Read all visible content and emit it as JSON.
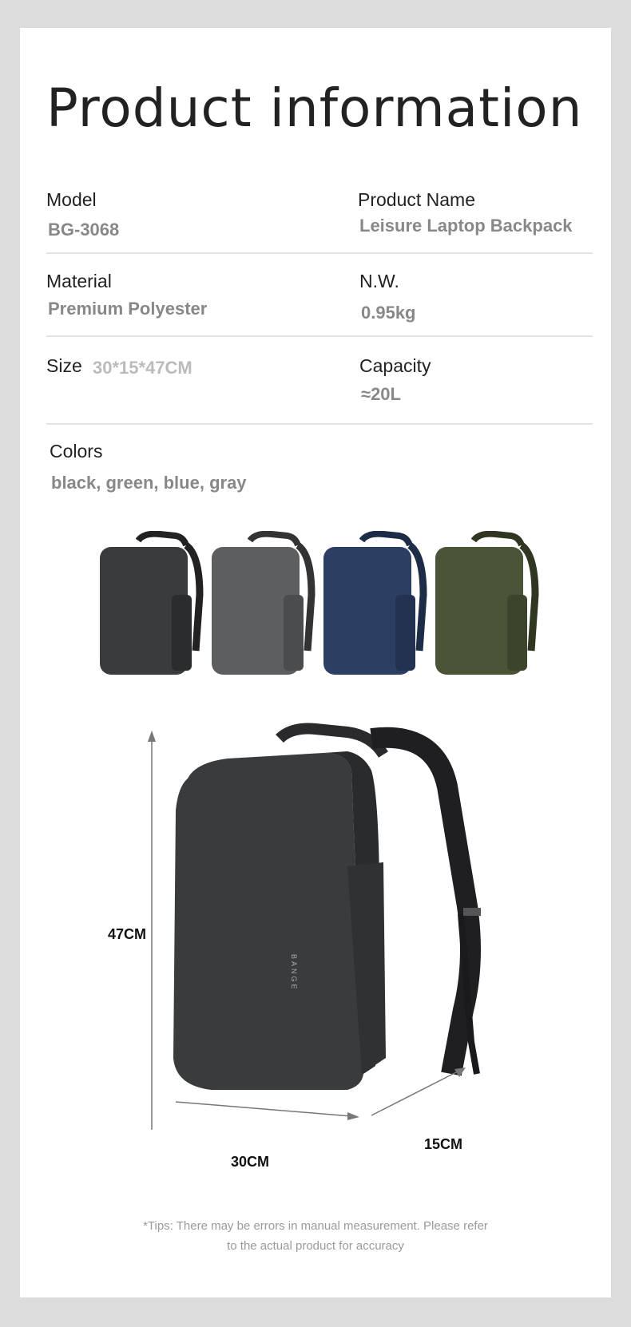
{
  "title": "Product information",
  "specs": {
    "model": {
      "label": "Model",
      "value": "BG-3068"
    },
    "product_name": {
      "label": "Product Name",
      "value": "Leisure Laptop Backpack"
    },
    "material": {
      "label": "Material",
      "value": "Premium Polyester"
    },
    "nw": {
      "label": "N.W.",
      "value": "0.95kg"
    },
    "size": {
      "label": "Size",
      "value": "30*15*47CM"
    },
    "capacity": {
      "label": "Capacity",
      "value": "≈20L"
    },
    "colors": {
      "label": "Colors",
      "value": "black, green, blue, gray"
    }
  },
  "variants": [
    {
      "name": "black",
      "color": "#3a3b3d"
    },
    {
      "name": "gray",
      "color": "#5d5e60"
    },
    {
      "name": "blue",
      "color": "#2c3f63"
    },
    {
      "name": "green",
      "color": "#4a5436"
    }
  ],
  "dimensions": {
    "height": "47CM",
    "width": "30CM",
    "depth": "15CM"
  },
  "brand_mark": "BANGE",
  "tips": {
    "line1": "*Tips: There may be errors in manual measurement. Please refer",
    "line2": "to the actual product for accuracy"
  }
}
